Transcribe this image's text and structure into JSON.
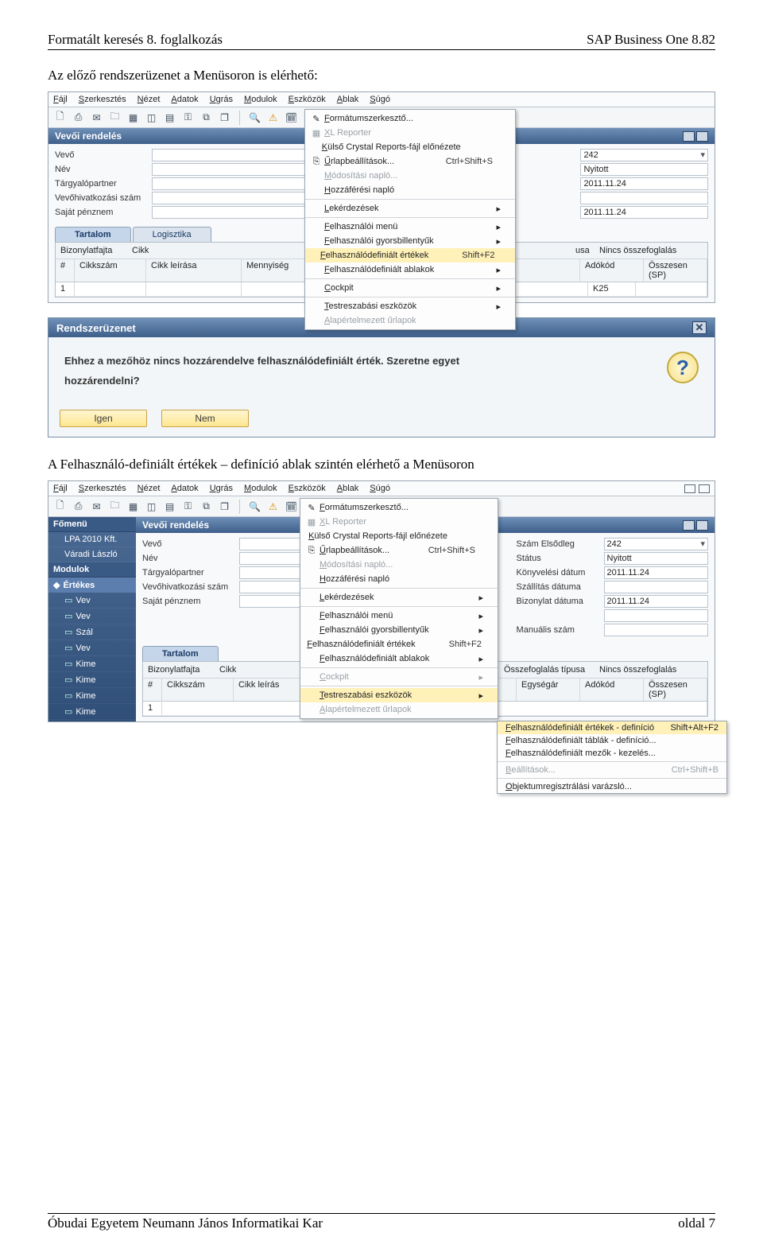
{
  "doc": {
    "header_left": "Formatált keresés 8. foglalkozás",
    "header_right": "SAP Business One 8.82",
    "para1": "Az előző rendszerüzenet a Menüsoron is elérhető:",
    "para2": "A Felhasználó-definiált értékek – definíció ablak szintén elérhető a Menüsoron",
    "footer_left": "Óbudai Egyetem Neumann János Informatikai Kar",
    "footer_right": "oldal 7"
  },
  "sap_menus": [
    "Fájl",
    "Szerkesztés",
    "Nézet",
    "Adatok",
    "Ugrás",
    "Modulok",
    "Eszközök",
    "Ablak",
    "Súgó"
  ],
  "toolbar_icons": [
    "page-icon",
    "print-icon",
    "mail-icon",
    "folder-icon",
    "excel-icon",
    "pdf-icon",
    "word-icon",
    "lock-icon",
    "doc-icon",
    "doc2-icon",
    "sep",
    "search-icon",
    "alert-icon",
    "calendar-icon",
    "help-icon",
    "sep",
    "copy-icon",
    "paste-icon"
  ],
  "dropdown1": [
    {
      "ic": "✎",
      "label": "Formátumszerkesztő...",
      "sc": "",
      "sub": false
    },
    {
      "ic": "▦",
      "label": "XL Reporter",
      "sc": "",
      "sub": false,
      "disabled": true
    },
    {
      "ic": "",
      "label": "Külső Crystal Reports-fájl előnézete",
      "sc": "",
      "sub": false
    },
    {
      "ic": "⎘",
      "label": "Űrlapbeállítások...",
      "sc": "Ctrl+Shift+S",
      "sub": false
    },
    {
      "ic": "",
      "label": "Módosítási napló...",
      "sc": "",
      "sub": false,
      "disabled": true
    },
    {
      "ic": "",
      "label": "Hozzáférési napló",
      "sc": "",
      "sub": false
    },
    {
      "sep": true
    },
    {
      "ic": "",
      "label": "Lekérdezések",
      "sc": "",
      "sub": true
    },
    {
      "sep": true
    },
    {
      "ic": "",
      "label": "Felhasználói menü",
      "sc": "",
      "sub": true
    },
    {
      "ic": "",
      "label": "Felhasználói gyorsbillentyűk",
      "sc": "",
      "sub": true
    },
    {
      "ic": "",
      "label": "Felhasználódefiniált értékek",
      "sc": "Shift+F2",
      "sub": false,
      "hl": true
    },
    {
      "ic": "",
      "label": "Felhasználódefiniált ablakok",
      "sc": "",
      "sub": true
    },
    {
      "sep": true
    },
    {
      "ic": "",
      "label": "Cockpit",
      "sc": "",
      "sub": true
    },
    {
      "sep": true
    },
    {
      "ic": "",
      "label": "Testreszabási eszközök",
      "sc": "",
      "sub": true
    },
    {
      "ic": "",
      "label": "Alapértelmezett űrlapok",
      "sc": "",
      "sub": false,
      "disabled": true
    }
  ],
  "form1": {
    "title": "Vevői rendelés",
    "left_fields": [
      {
        "label": "Vevő",
        "value": ""
      },
      {
        "label": "Név",
        "value": ""
      },
      {
        "label": "Tárgyalópartner",
        "value": "",
        "combo": true
      },
      {
        "label": "Vevőhivatkozási szám",
        "value": ""
      },
      {
        "label": "Saját pénznem",
        "value": "",
        "combo": true
      }
    ],
    "right_fields": [
      {
        "label": "",
        "value": "242",
        "combo": true
      },
      {
        "label": "",
        "value": "Nyitott"
      },
      {
        "label": "",
        "value": "2011.11.24"
      },
      {
        "label": "",
        "value": ""
      },
      {
        "label": "",
        "value": "2011.11.24"
      }
    ],
    "tabs": [
      "Tartalom",
      "Logisztika"
    ],
    "grid": {
      "bizonylatfajta_label": "Bizonylatfajta",
      "bizonylatfajta_value": "Cikk",
      "cols": [
        "#",
        "Cikkszám",
        "Cikk leírása",
        "Mennyiség"
      ],
      "right_cols_label": "usa",
      "right_cols_value": "Nincs összefoglalás",
      "right_cols2": [
        "Adókód",
        "Összesen (SP)"
      ],
      "rownum": "1",
      "k25": "K25"
    }
  },
  "msgbox": {
    "title": "Rendszerüzenet",
    "text_line1": "Ehhez a mezőhöz nincs hozzárendelve felhasználódefiniált érték. Szeretne egyet",
    "text_line2": "hozzárendelni?",
    "btn_yes": "Igen",
    "btn_no": "Nem"
  },
  "shot2": {
    "sidebar": {
      "header": "Főmenü",
      "company": "LPA 2010 Kft.",
      "user": "Váradi László",
      "mod_label": "Modulok",
      "cat": "Értékes",
      "items": [
        "Vev",
        "Vev",
        "Szál",
        "Vev",
        "Kime",
        "Kime",
        "Kime",
        "Kime"
      ]
    },
    "form_title": "Vevői rendelés",
    "left_fields": [
      {
        "label": "Vevő",
        "value": ""
      },
      {
        "label": "Név",
        "value": ""
      },
      {
        "label": "Tárgyalópartner",
        "value": "",
        "combo": true
      },
      {
        "label": "Vevőhivatkozási szám",
        "value": ""
      },
      {
        "label": "Saját pénznem",
        "value": "",
        "combo": true
      }
    ],
    "right_fields": [
      {
        "label": "Szám",
        "extra": "Elsődleg",
        "value": "242",
        "combo": true
      },
      {
        "label": "Státus",
        "value": "Nyitott"
      },
      {
        "label": "Könyvelési dátum",
        "value": "2011.11.24"
      },
      {
        "label": "Szállítás dátuma",
        "value": ""
      },
      {
        "label": "Bizonylat dátuma",
        "value": "2011.11.24"
      },
      {
        "label": "",
        "value": ""
      },
      {
        "label": "Manuális szám",
        "value": ""
      }
    ],
    "tabs": [
      "Tartalom"
    ],
    "grid": {
      "bizonylatfajta_label": "Bizonylatfajta",
      "bizonylatfajta_value": "Cikk",
      "cols": [
        "#",
        "Cikkszám",
        "Cikk leírás"
      ],
      "rb_label": "Összefoglalás típusa",
      "rb_value": "Nincs összefoglalás",
      "rb_cols": [
        "Egységár",
        "Adókód",
        "Összesen (SP)"
      ],
      "rownum": "1"
    },
    "dropdown": [
      {
        "ic": "✎",
        "label": "Formátumszerkesztő...",
        "sc": ""
      },
      {
        "ic": "▦",
        "label": "XL Reporter",
        "sc": "",
        "disabled": true
      },
      {
        "ic": "",
        "label": "Külső Crystal Reports-fájl előnézete",
        "sc": ""
      },
      {
        "ic": "⎘",
        "label": "Űrlapbeállítások...",
        "sc": "Ctrl+Shift+S"
      },
      {
        "ic": "",
        "label": "Módosítási napló...",
        "sc": "",
        "disabled": true
      },
      {
        "ic": "",
        "label": "Hozzáférési napló",
        "sc": ""
      },
      {
        "sep": true
      },
      {
        "ic": "",
        "label": "Lekérdezések",
        "sc": "",
        "sub": true
      },
      {
        "sep": true
      },
      {
        "ic": "",
        "label": "Felhasználói menü",
        "sc": "",
        "sub": true
      },
      {
        "ic": "",
        "label": "Felhasználói gyorsbillentyűk",
        "sc": "",
        "sub": true
      },
      {
        "ic": "",
        "label": "Felhasználódefiniált értékek",
        "sc": "Shift+F2"
      },
      {
        "ic": "",
        "label": "Felhasználódefiniált ablakok",
        "sc": "",
        "sub": true
      },
      {
        "sep": true
      },
      {
        "ic": "",
        "label": "Cockpit",
        "sc": "",
        "sub": true,
        "disabled": true
      },
      {
        "sep": true
      },
      {
        "ic": "",
        "label": "Testreszabási eszközök",
        "sc": "",
        "sub": true,
        "hl": true
      },
      {
        "ic": "",
        "label": "Alapértelmezett űrlapok",
        "sc": "",
        "disabled": true
      }
    ],
    "submenu": [
      {
        "label": "Felhasználódefiniált értékek - definíció",
        "sc": "Shift+Alt+F2",
        "hl": true
      },
      {
        "label": "Felhasználódefiniált táblák - definíció...",
        "sc": ""
      },
      {
        "label": "Felhasználódefiniált mezők - kezelés...",
        "sc": ""
      },
      {
        "sep": true
      },
      {
        "label": "Beállítások...",
        "sc": "Ctrl+Shift+B",
        "disabled": true
      },
      {
        "sep": true
      },
      {
        "label": "Objektumregisztrálási varázsló...",
        "sc": ""
      }
    ]
  }
}
